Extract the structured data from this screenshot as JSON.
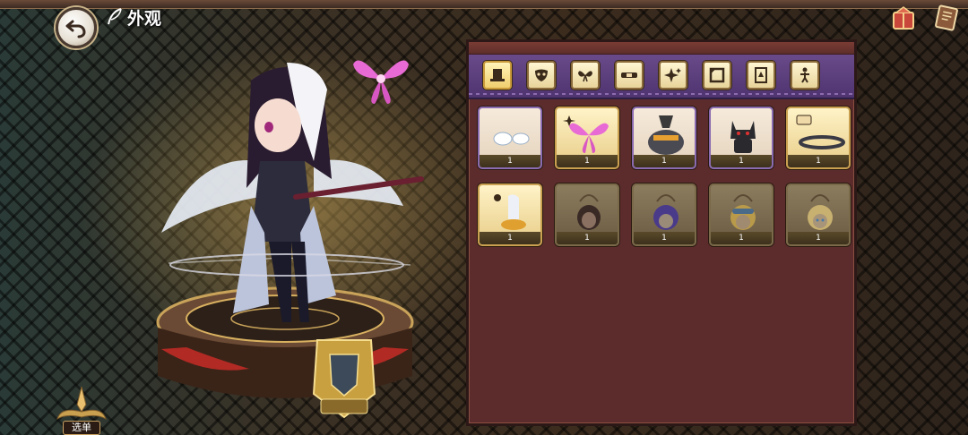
{
  "header": {
    "title": "外观"
  },
  "menu_button": {
    "label": "选单"
  },
  "tabs": [
    {
      "icon": "hat-icon",
      "active": true
    },
    {
      "icon": "mask-icon",
      "active": false
    },
    {
      "icon": "wings-icon",
      "active": false
    },
    {
      "icon": "belt-icon",
      "active": false
    },
    {
      "icon": "sparkle-icon",
      "active": false
    },
    {
      "icon": "frame-icon",
      "active": false
    },
    {
      "icon": "card-frame-icon",
      "active": false
    },
    {
      "icon": "pose-icon",
      "active": false
    }
  ],
  "items": [
    {
      "name": "cloud-accessory",
      "count": "1",
      "style": "rare"
    },
    {
      "name": "pink-butterfly-wings",
      "count": "1",
      "style": "gold"
    },
    {
      "name": "witch-pot-hat",
      "count": "1",
      "style": "rare"
    },
    {
      "name": "black-cat-plush",
      "count": "1",
      "style": "rare"
    },
    {
      "name": "studded-belt",
      "count": "1",
      "style": "rare"
    },
    {
      "name": "character-pose-badge",
      "count": "1",
      "style": "gold"
    },
    {
      "name": "portrait-dark-hair-girl",
      "count": "1",
      "style": "dim"
    },
    {
      "name": "portrait-purple-hair-girl",
      "count": "1",
      "style": "dim"
    },
    {
      "name": "portrait-blonde-goggles-girl",
      "count": "1",
      "style": "dim"
    },
    {
      "name": "portrait-blonde-blue-eyes-girl",
      "count": "1",
      "style": "dim"
    }
  ],
  "colors": {
    "panel": "#5c2c2c",
    "tabbar": "#5a3c7c",
    "gold": "#e7cc86"
  }
}
